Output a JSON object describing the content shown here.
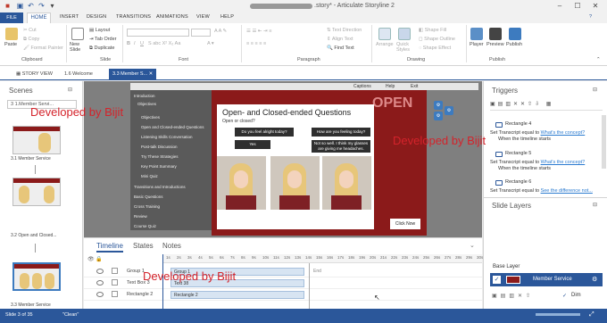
{
  "window": {
    "title": ".story* - Articulate Storyline 2"
  },
  "ribbon": {
    "tabs": [
      "FILE",
      "HOME",
      "INSERT",
      "DESIGN",
      "TRANSITIONS",
      "ANIMATIONS",
      "VIEW",
      "HELP"
    ],
    "clipboard": {
      "paste": "Paste",
      "cut": "Cut",
      "copy": "Copy",
      "format_painter": "Format Painter",
      "label": "Clipboard"
    },
    "slide": {
      "new_slide": "New Slide",
      "layout": "Layout",
      "tab_order": "Tab Order",
      "duplicate": "Duplicate",
      "label": "Slide"
    },
    "font": {
      "label": "Font"
    },
    "paragraph": {
      "text_direction": "Text Direction",
      "align_text": "Align Text",
      "find_text": "Find Text",
      "label": "Paragraph"
    },
    "drawing": {
      "arrange": "Arrange",
      "quick_styles": "Quick Styles",
      "shape_fill": "Shape Fill",
      "shape_outline": "Shape Outline",
      "shape_effect": "Shape Effect",
      "label": "Drawing"
    },
    "publish": {
      "player": "Player",
      "preview": "Preview",
      "publish": "Publish",
      "label": "Publish"
    }
  },
  "doctabs": [
    "STORY VIEW",
    "1.6 Welcome",
    "3.3 Member S..."
  ],
  "scenes": {
    "title": "Scenes",
    "dropdown": "3 1.Member Servi...",
    "items": [
      "3.1 Member Service",
      "3.2 Open and Closed...",
      "3.3 Member Service"
    ]
  },
  "slide": {
    "nav_items": [
      "Introduction",
      "Objectives",
      "Objectives",
      "Open and Closed-ended Questions",
      "Listening Skills Conversation",
      "Post-talk Discussion",
      "Try These Strategies",
      "Key Point Summary",
      "Mini Quiz",
      "Transitions and Introductions",
      "Basic Questions",
      "Cross Training",
      "Review",
      "Course Quiz"
    ],
    "top_buttons": [
      "Captions",
      "Help",
      "Exit"
    ],
    "question_title": "Open- and Closed-ended Questions",
    "question_sub": "Open or closed?",
    "q1": "Do you feel alright today?",
    "q1_ans": "Yes",
    "q2": "How are you feeling today?",
    "q2_ans": "Not so well. I think my glasses are giving me headaches.",
    "word_open": "OPEN",
    "click_now": "Click Now"
  },
  "timeline": {
    "tabs": [
      "Timeline",
      "States",
      "Notes"
    ],
    "ticks": [
      "1s",
      "2s",
      "3s",
      "4s",
      "5s",
      "6s",
      "7s",
      "8s",
      "9s",
      "10s",
      "11s",
      "12s",
      "13s",
      "14s",
      "15s",
      "16s",
      "17s",
      "18s",
      "19s",
      "20s",
      "21s",
      "22s",
      "23s",
      "24s",
      "25s",
      "26s",
      "27s",
      "28s",
      "29s",
      "30s"
    ],
    "rows": [
      {
        "name": "Group 1",
        "bar": "Group 1"
      },
      {
        "name": "Text Box 3",
        "bar": "Text 38"
      },
      {
        "name": "Rectangle 2",
        "bar": "Rectangle 2"
      }
    ],
    "end_label": "End"
  },
  "triggers": {
    "title": "Triggers",
    "items": [
      {
        "name": "Rectangle 4",
        "action": "Set Transcript equal to",
        "link": "What's the concept?",
        "when": "When the timeline starts"
      },
      {
        "name": "Rectangle 5",
        "action": "Set Transcript equal to",
        "link": "What's the concept?",
        "when": "When the timeline starts"
      },
      {
        "name": "Rectangle 6",
        "action": "Set Transcript equal to",
        "link": "See the difference not...",
        "when": ""
      }
    ]
  },
  "layers": {
    "title": "Slide Layers",
    "base_layer": "Base Layer",
    "member_service": "Member Service",
    "dim": "Dim"
  },
  "status": {
    "slide": "Slide 3 of 35",
    "theme": "\"Clean\""
  },
  "watermarks": [
    "Developed by Bijit",
    "Developed by Bijit",
    "Developed by Bijit"
  ],
  "colors": {
    "accent": "#2b579a",
    "slide_red": "#8b1a1a",
    "watermark": "#d4232b"
  }
}
